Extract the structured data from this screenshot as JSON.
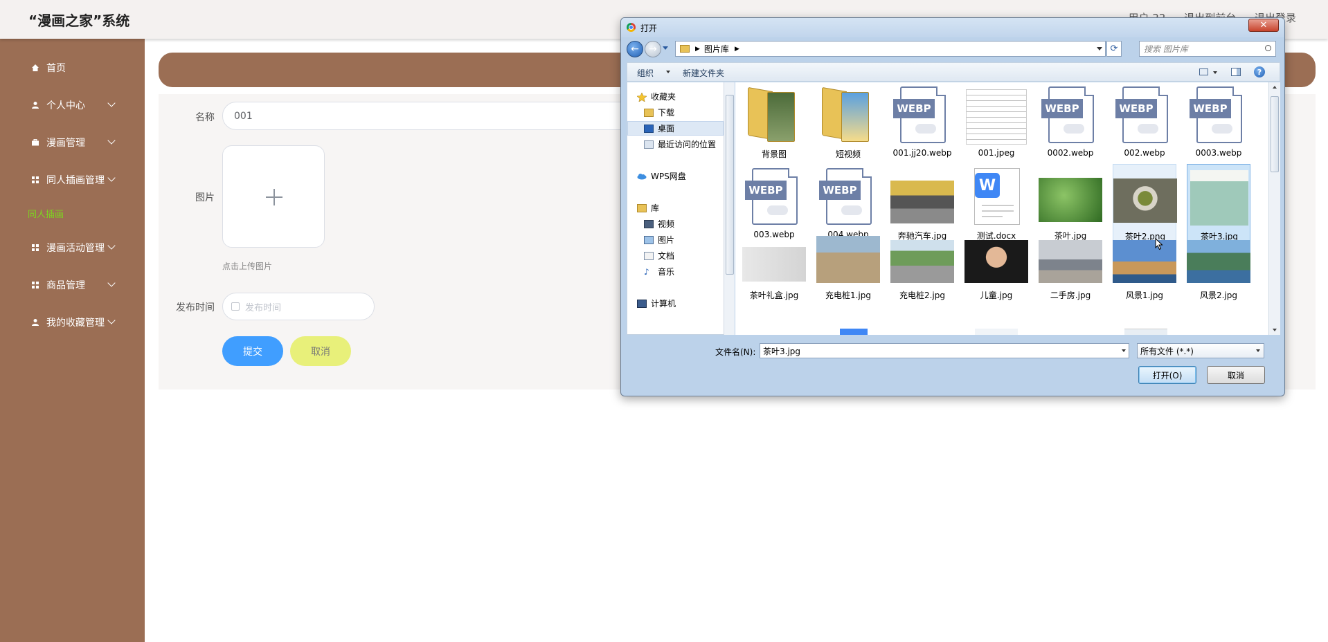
{
  "app": {
    "title": "“漫画之家”系统"
  },
  "header": {
    "links": [
      "用户 22",
      "退出到前台",
      "退出登录"
    ]
  },
  "sidebar": {
    "items": [
      {
        "label": "首页",
        "icon": "home-icon"
      },
      {
        "label": "个人中心",
        "icon": "user-icon"
      },
      {
        "label": "漫画管理",
        "icon": "briefcase-icon"
      },
      {
        "label": "同人插画管理",
        "icon": "grid-icon"
      },
      {
        "label": "同人插画",
        "icon": ""
      },
      {
        "label": "漫画活动管理",
        "icon": "grid-icon"
      },
      {
        "label": "商品管理",
        "icon": "grid-icon"
      },
      {
        "label": "我的收藏管理",
        "icon": "user-icon"
      }
    ],
    "active_sub_color": "#7ed321",
    "bg_color": "#9b6e54"
  },
  "form": {
    "name_label": "名称",
    "name_value": "001",
    "image_label": "图片",
    "upload_hint": "点击上传图片",
    "date_label": "发布时间",
    "date_placeholder": "发布时间",
    "submit_label": "提交",
    "cancel_label": "取消"
  },
  "dialog": {
    "title": "打开",
    "close_label": "✕",
    "address": "图片库",
    "search_placeholder": "搜索 图片库",
    "toolbar": {
      "organize": "组织",
      "new_folder": "新建文件夹"
    },
    "nav": {
      "favorites": "收藏夹",
      "downloads": "下载",
      "desktop": "桌面",
      "recent": "最近访问的位置",
      "wps": "WPS网盘",
      "library": "库",
      "videos": "视频",
      "pictures": "图片",
      "documents": "文档",
      "music": "音乐",
      "computer": "计算机"
    },
    "files": [
      {
        "name": "背景图",
        "kind": "folder"
      },
      {
        "name": "短视频",
        "kind": "folder"
      },
      {
        "name": "001.jj20.webp",
        "kind": "webp"
      },
      {
        "name": "001.jpeg",
        "kind": "doc-image"
      },
      {
        "name": "0002.webp",
        "kind": "webp"
      },
      {
        "name": "002.webp",
        "kind": "webp"
      },
      {
        "name": "0003.webp",
        "kind": "webp"
      },
      {
        "name": "003.webp",
        "kind": "webp"
      },
      {
        "name": "004.webp",
        "kind": "webp"
      },
      {
        "name": "奔驰汽车.jpg",
        "kind": "photo"
      },
      {
        "name": "测试.docx",
        "kind": "docx"
      },
      {
        "name": "茶叶.jpg",
        "kind": "photo"
      },
      {
        "name": "茶叶2.png",
        "kind": "photo"
      },
      {
        "name": "茶叶3.jpg",
        "kind": "photo"
      },
      {
        "name": "茶叶礼盒.jpg",
        "kind": "photo"
      },
      {
        "name": "充电桩1.jpg",
        "kind": "photo"
      },
      {
        "name": "充电桩2.jpg",
        "kind": "photo"
      },
      {
        "name": "儿童.jpg",
        "kind": "photo"
      },
      {
        "name": "二手房.jpg",
        "kind": "photo"
      },
      {
        "name": "风景1.jpg",
        "kind": "photo"
      },
      {
        "name": "风景2.jpg",
        "kind": "photo"
      }
    ],
    "filename_label": "文件名(N):",
    "filename_value": "茶叶3.jpg",
    "filetype_value": "所有文件 (*.*)",
    "open_label": "打开(O)",
    "cancel_label": "取消"
  }
}
